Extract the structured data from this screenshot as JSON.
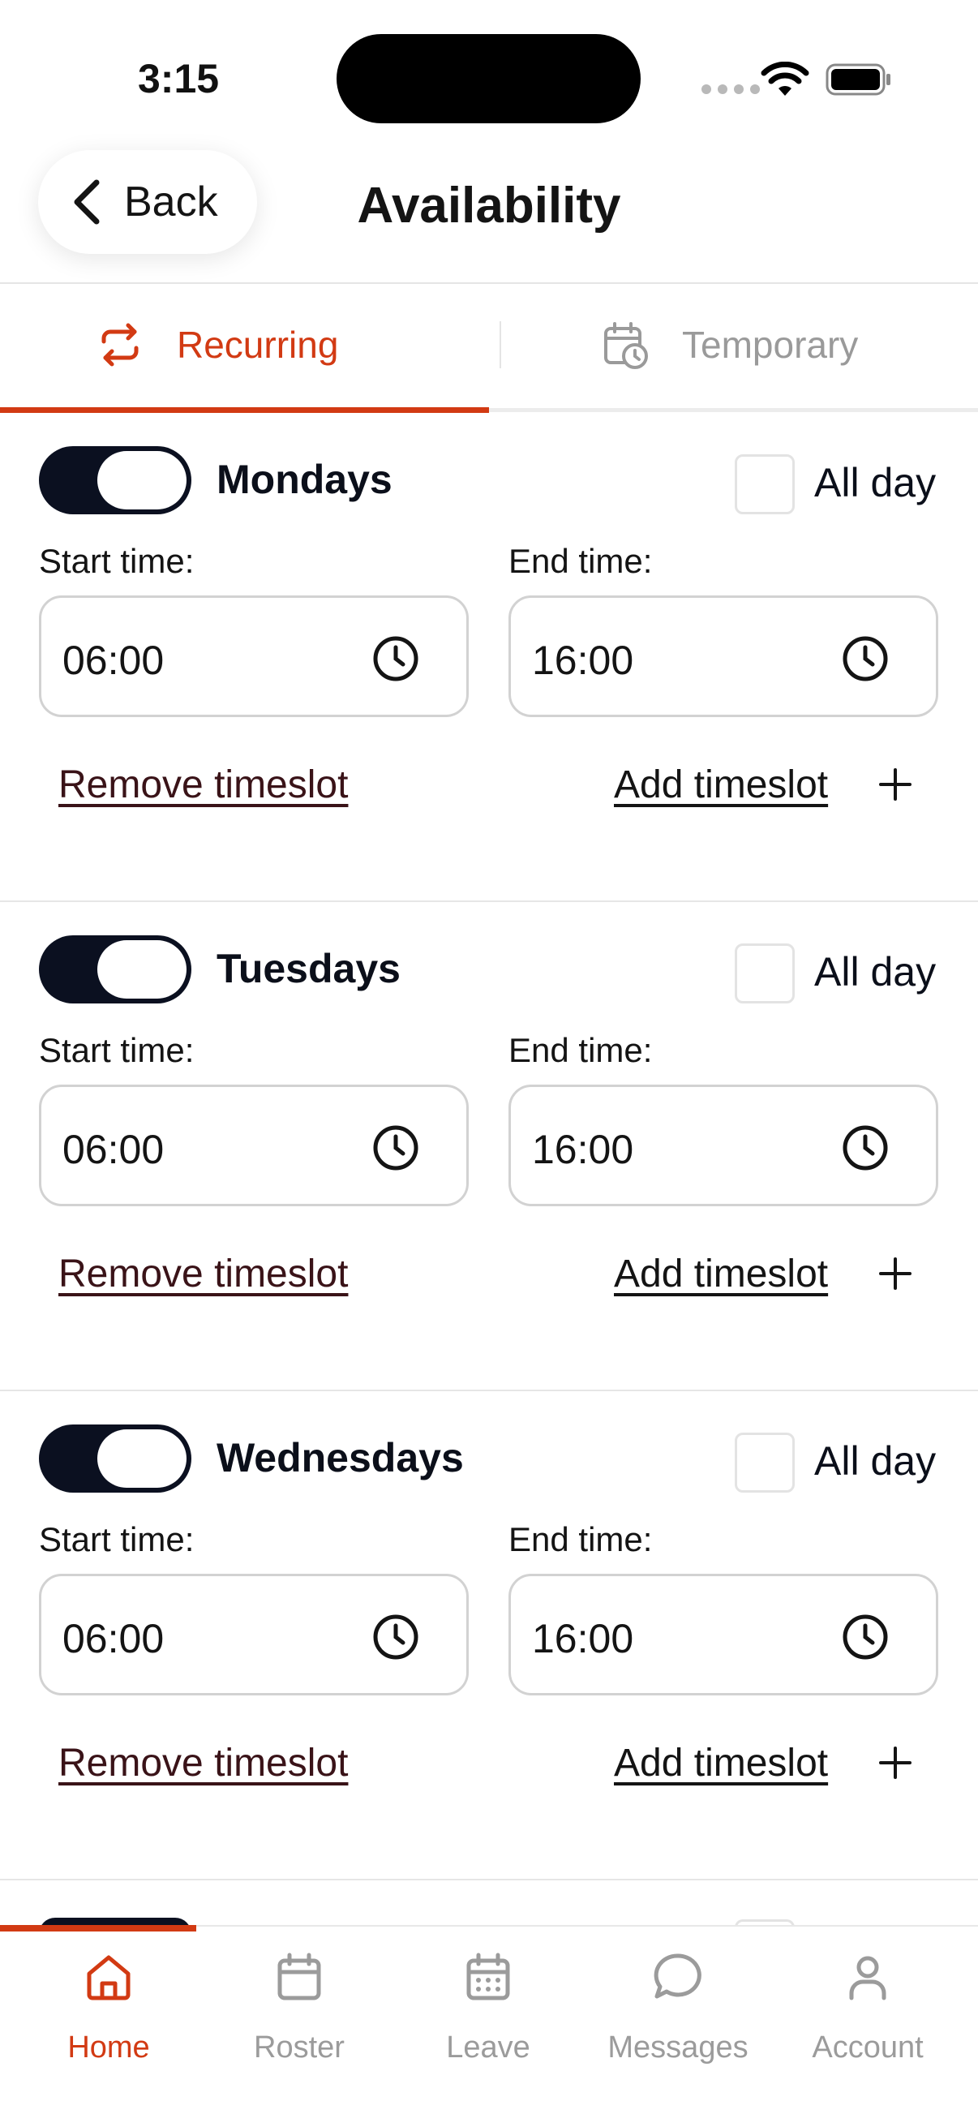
{
  "status_bar": {
    "time": "3:15"
  },
  "header": {
    "back_label": "Back",
    "title": "Availability"
  },
  "tabs": [
    {
      "label": "Recurring",
      "active": true
    },
    {
      "label": "Temporary",
      "active": false
    }
  ],
  "days": [
    {
      "name": "Mondays",
      "enabled": true,
      "all_day_label": "All day",
      "all_day": false,
      "start_label": "Start time:",
      "end_label": "End time:",
      "start": "06:00",
      "end": "16:00",
      "remove_label": "Remove timeslot",
      "add_label": "Add timeslot"
    },
    {
      "name": "Tuesdays",
      "enabled": true,
      "all_day_label": "All day",
      "all_day": false,
      "start_label": "Start time:",
      "end_label": "End time:",
      "start": "06:00",
      "end": "16:00",
      "remove_label": "Remove timeslot",
      "add_label": "Add timeslot"
    },
    {
      "name": "Wednesdays",
      "enabled": true,
      "all_day_label": "All day",
      "all_day": false,
      "start_label": "Start time:",
      "end_label": "End time:",
      "start": "06:00",
      "end": "16:00",
      "remove_label": "Remove timeslot",
      "add_label": "Add timeslot"
    }
  ],
  "bottom_nav": [
    {
      "label": "Home",
      "icon": "home-icon",
      "active": true
    },
    {
      "label": "Roster",
      "icon": "calendar-icon",
      "active": false
    },
    {
      "label": "Leave",
      "icon": "calendar-grid-icon",
      "active": false
    },
    {
      "label": "Messages",
      "icon": "chat-bubble-icon",
      "active": false
    },
    {
      "label": "Account",
      "icon": "person-icon",
      "active": false
    }
  ],
  "colors": {
    "accent": "#d23a13",
    "toggle_on": "#0b1020",
    "muted": "#9b9b9b"
  }
}
